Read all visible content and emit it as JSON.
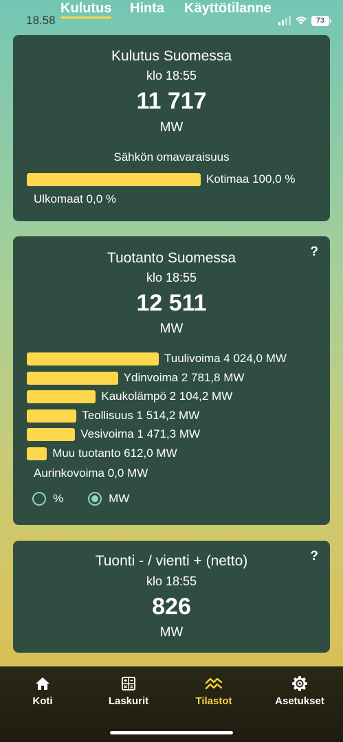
{
  "status": {
    "time": "18.58",
    "battery": "73"
  },
  "top_tabs": [
    {
      "label": "Kulutus",
      "active": true
    },
    {
      "label": "Hinta",
      "active": false
    },
    {
      "label": "Käyttötilanne",
      "active": false
    }
  ],
  "consumption": {
    "title": "Kulutus Suomessa",
    "time": "klo 18:55",
    "value": "11 717",
    "unit": "MW",
    "self_sufficiency_label": "Sähkön omavaraisuus",
    "domestic_label": "Kotimaa 100,0 %",
    "domestic_fraction": 1.0,
    "foreign_label": "Ulkomaat 0,0 %",
    "foreign_fraction": 0.0
  },
  "production": {
    "title": "Tuotanto Suomessa",
    "help": "?",
    "time": "klo 18:55",
    "value": "12 511",
    "unit": "MW",
    "sources": [
      {
        "label": "Tuulivoima 4 024,0 MW",
        "value": 4024.0
      },
      {
        "label": "Ydinvoima 2 781,8 MW",
        "value": 2781.8
      },
      {
        "label": "Kaukolämpö 2 104,2 MW",
        "value": 2104.2
      },
      {
        "label": "Teollisuus 1 514,2 MW",
        "value": 1514.2
      },
      {
        "label": "Vesivoima 1 471,3 MW",
        "value": 1471.3
      },
      {
        "label": "Muu tuotanto 612,0 MW",
        "value": 612.0
      },
      {
        "label": "Aurinkovoima 0,0 MW",
        "value": 0.0
      }
    ],
    "unit_options": [
      {
        "label": "%",
        "selected": false
      },
      {
        "label": "MW",
        "selected": true
      }
    ]
  },
  "net_import": {
    "title": "Tuonti - / vienti + (netto)",
    "help": "?",
    "time": "klo 18:55",
    "value": "826",
    "unit": "MW"
  },
  "bottom_nav": [
    {
      "label": "Koti",
      "icon": "home-icon",
      "active": false
    },
    {
      "label": "Laskurit",
      "icon": "calculator-icon",
      "active": false
    },
    {
      "label": "Tilastot",
      "icon": "chart-icon",
      "active": true
    },
    {
      "label": "Asetukset",
      "icon": "gear-icon",
      "active": false
    }
  ],
  "colors": {
    "card": "#2f4d41",
    "bar": "#fdd84d",
    "active_nav": "#f6cf45"
  }
}
